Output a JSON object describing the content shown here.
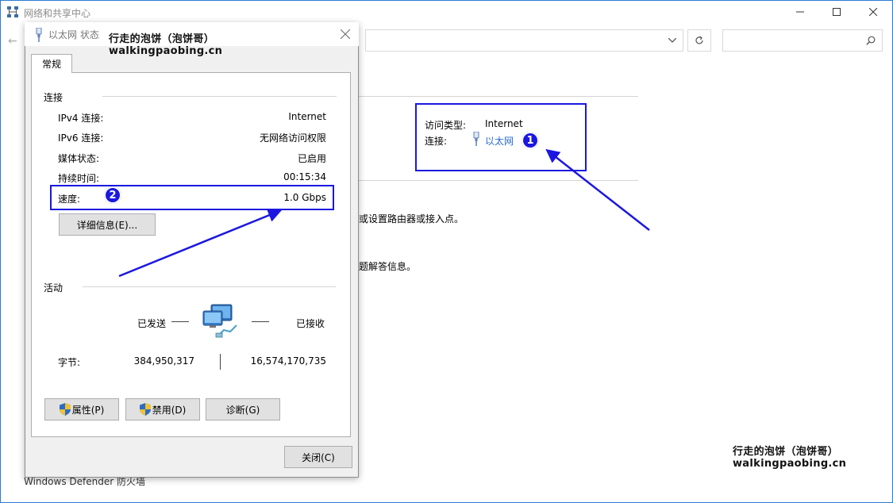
{
  "window": {
    "title": "网络和共享中心"
  },
  "background": {
    "access_type_label": "访问类型:",
    "access_type_value": "Internet",
    "connections_label": "连接:",
    "connections_link": "以太网",
    "text_router": "或设置路由器或接入点。",
    "text_troubleshoot": "题解答信息。",
    "firewall_link": "Windows Defender 防火墙"
  },
  "dialog": {
    "title": "以太网 状态",
    "tab_general": "常规",
    "connection_group": "连接",
    "rows": {
      "ipv4_label": "IPv4 连接:",
      "ipv4_value": "Internet",
      "ipv6_label": "IPv6 连接:",
      "ipv6_value": "无网络访问权限",
      "media_label": "媒体状态:",
      "media_value": "已启用",
      "duration_label": "持续时间:",
      "duration_value": "00:15:34",
      "speed_label": "速度:",
      "speed_value": "1.0 Gbps"
    },
    "details_button": "详细信息(E)...",
    "activity_group": "活动",
    "sent_label": "已发送",
    "received_label": "已接收",
    "bytes_label": "字节:",
    "bytes_sent": "384,950,317",
    "bytes_received": "16,574,170,735",
    "properties_button": "属性(P)",
    "disable_button": "禁用(D)",
    "diagnose_button": "诊断(G)",
    "close_button": "关闭(C)"
  },
  "watermark": {
    "line1": "行走的泡饼（泡饼哥）",
    "line2": "walkingpaobing.cn"
  },
  "annotations": {
    "badge_1": "1",
    "badge_2": "2",
    "accent_color": "#1b17e0"
  },
  "icons": {
    "title_icon": "network-sharing-center-icon",
    "ethernet_icon": "ethernet-plug-icon",
    "network_activity_icon": "network-computers-icon",
    "shield_icon": "uac-shield-icon"
  }
}
